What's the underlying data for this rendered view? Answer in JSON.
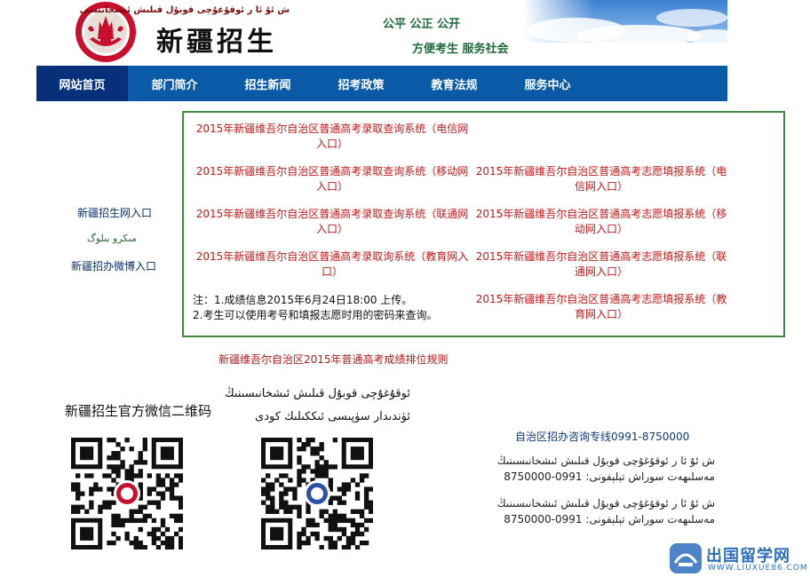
{
  "header": {
    "uyghur_title": "ش ئۇ ئا ر ئوقۇغۇچى قوبۇل قىلىش ئىشخانىسى",
    "site_title": "新疆招生",
    "slogan_line1": "公平 公正 公开",
    "slogan_line2": "方便考生  服务社会",
    "logo_text": "新疆招生",
    "brand_color": "#c8102e"
  },
  "nav": {
    "items": [
      {
        "label": "网站首页",
        "active": true
      },
      {
        "label": "部门简介",
        "active": false
      },
      {
        "label": "招生新闻",
        "active": false
      },
      {
        "label": "招考政策",
        "active": false
      },
      {
        "label": "教育法规",
        "active": false
      },
      {
        "label": "服务中心",
        "active": false
      }
    ],
    "bg_color": "#0a5aa8",
    "active_color": "#06307a"
  },
  "left_links": [
    "新疆招生网入口",
    "مىكرو بىلوگ",
    "新疆招办微博入口"
  ],
  "query_box": {
    "left_links": [
      "2015年新疆维吾尔自治区普通高考录取查询系统（电信网入口）",
      "2015年新疆维吾尔自治区普通高考录取查询系统（移动网入口）",
      "2015年新疆维吾尔自治区普通高考录取查询系统（联通网入口）",
      "2015年新疆维吾尔自治区普通高考录取询系统（教育网入口）"
    ],
    "right_links": [
      "2015年新疆维吾尔自治区普通高考志愿填报系统（电信网入口）",
      "2015年新疆维吾尔自治区普通高考志愿填报系统（移动网入口）",
      "2015年新疆维吾尔自治区普通高考志愿填报系统（联通网入口）",
      "2015年新疆维吾尔自治区普通高考志愿填报系统（教育网入口）"
    ],
    "note_line1": "注：1.成绩信息2015年6月24日18:00 上传。",
    "note_line2": "2.考生可以使用考号和填报志愿时用的密码来查询。",
    "border_color": "#3f8a3f",
    "link_color": "#c21a1a"
  },
  "ranking_link": "新疆维吾尔自治区2015年普通高考成绩排位规则",
  "qr_section": {
    "wechat_caption": "新疆招生官方微信二维码",
    "uyghur_caption_line1": "ئوقۇغۇچى قوبۇل قىلىش ئىشخانىسىنىڭ",
    "uyghur_caption_line2": "ئۈندىدار سۈپىسى ئىككىلىك كودى"
  },
  "hotline": {
    "label": "自治区招办咨询专线0991-8750000",
    "uyghur_line1_a": "ش ئۇ ئا ر ئوقۇغۇچى قوبۇل قىلىش ئىشخانىسىنىڭ",
    "uyghur_line1_b": "مەسلىھەت سوراش تېلېفونى: 0991-8750000",
    "uyghur_line2_a": "ش ئۇ ئا ر ئوقۇغۇچى قوبۇل قىلىش ئىشخانىسىنىڭ",
    "uyghur_line2_b": "مەسلىھەت سوراش تېلېفونى: 0991-8750000"
  },
  "watermark": {
    "text": "出国留学网",
    "url": "WWW.LIUXUE86.COM"
  }
}
